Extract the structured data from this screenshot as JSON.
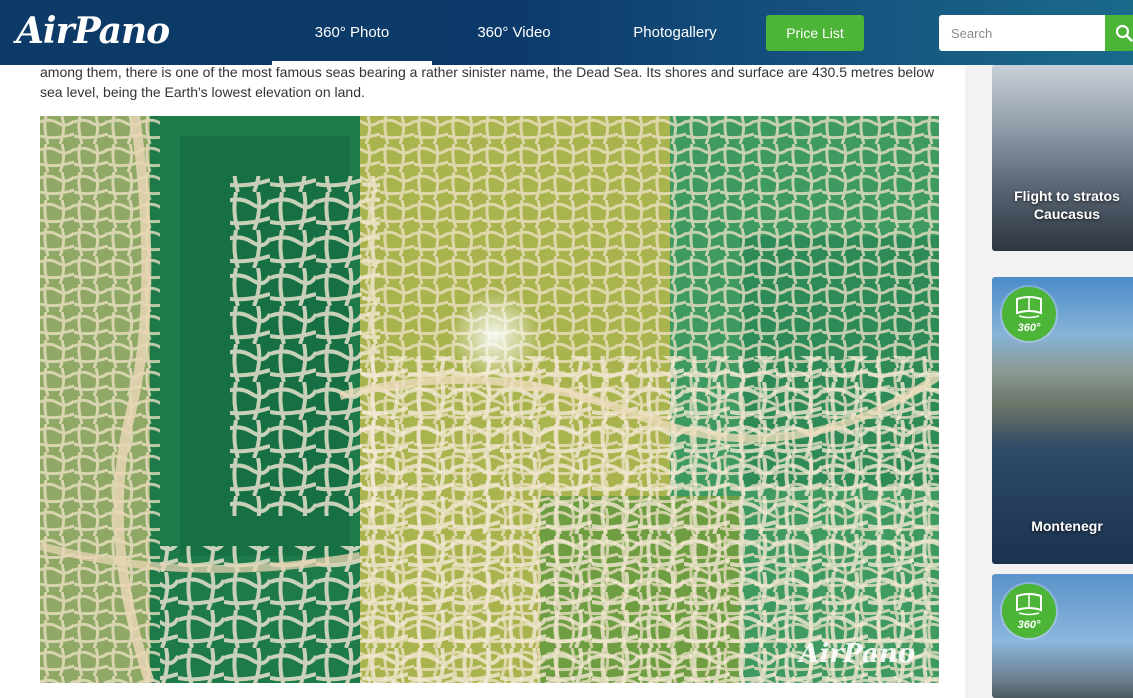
{
  "header": {
    "logo": "AirPano",
    "nav": [
      {
        "label": "360° Photo",
        "active": true
      },
      {
        "label": "360° Video"
      },
      {
        "label": "Photogallery"
      }
    ],
    "price_button": "Price List",
    "search_placeholder": "Search"
  },
  "main": {
    "intro": "among them, there is one of the most famous seas bearing a rather sinister name, the Dead Sea. Its shores and surface are 430.5 metres below sea level, being the Earth's lowest elevation on land.",
    "photo_watermark": "AirPano"
  },
  "sidebar": {
    "cards": [
      {
        "title": "Flight to stratos Caucasus"
      },
      {
        "title": "Montenegr",
        "badge": "360°"
      },
      {
        "badge": "360°"
      }
    ]
  },
  "colors": {
    "header_bg": "#0d3a66",
    "accent_green": "#4cb436"
  }
}
